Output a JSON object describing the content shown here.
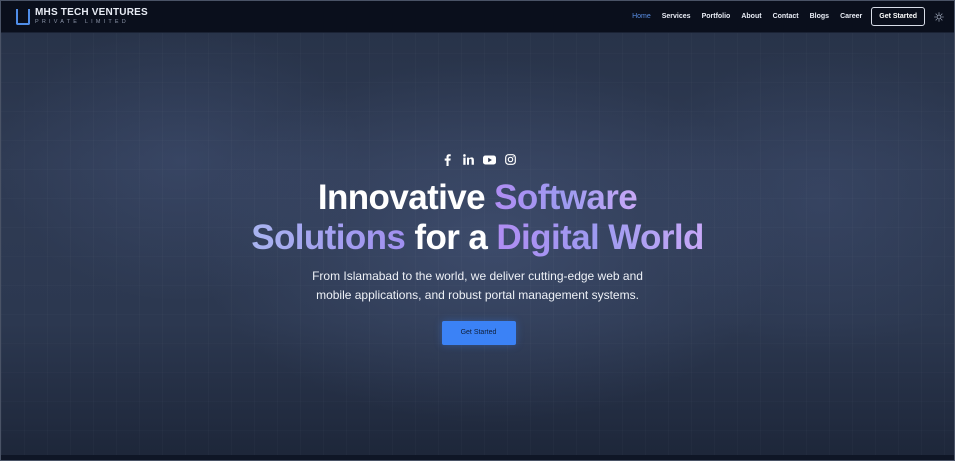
{
  "brand": {
    "name": "MHS TECH VENTURES",
    "subtitle": "PRIVATE LIMITED"
  },
  "nav": {
    "items": [
      {
        "label": "Home",
        "active": true
      },
      {
        "label": "Services",
        "active": false
      },
      {
        "label": "Portfolio",
        "active": false
      },
      {
        "label": "About",
        "active": false
      },
      {
        "label": "Contact",
        "active": false
      },
      {
        "label": "Blogs",
        "active": false
      },
      {
        "label": "Career",
        "active": false
      }
    ],
    "cta_label": "Get Started",
    "theme_icon": "sun-icon"
  },
  "hero": {
    "socials": [
      "facebook-icon",
      "linkedin-icon",
      "youtube-icon",
      "instagram-icon"
    ],
    "headline": {
      "part1": "Innovative ",
      "part2": "Software",
      "part3": "Solutions",
      "part4": " for a ",
      "part5": "Digital World"
    },
    "subtext": "From Islamabad to the world, we deliver cutting-edge web and mobile applications, and robust portal management systems.",
    "cta_label": "Get Started"
  },
  "colors": {
    "accent": "#3b82f6",
    "nav_active": "#5a8fe6",
    "gradient_start": "#b08df3",
    "gradient_end": "#c8a8f7",
    "background": "#2c3850"
  }
}
